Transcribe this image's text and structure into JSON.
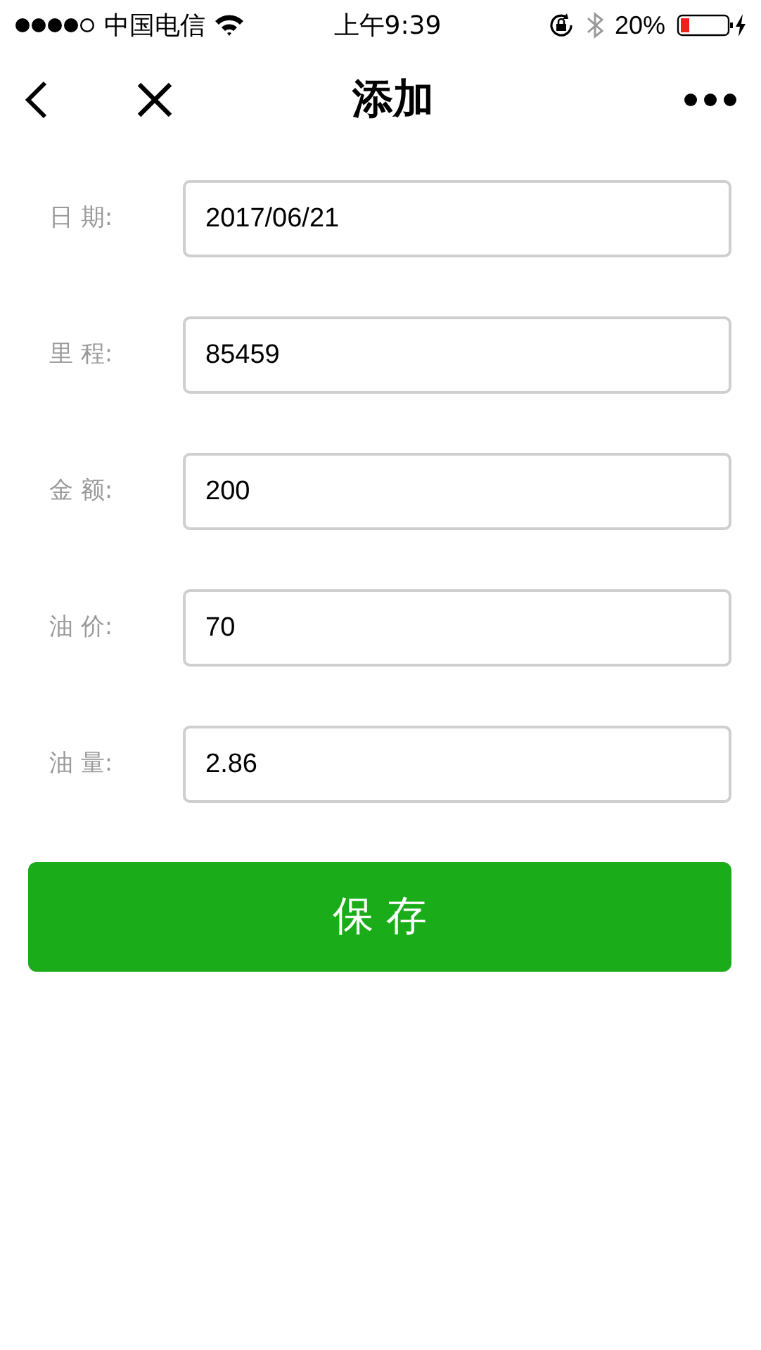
{
  "status_bar": {
    "carrier": "中国电信",
    "time": "上午9:39",
    "battery": "20%"
  },
  "nav_bar": {
    "title": "添加"
  },
  "form": {
    "fields": [
      {
        "label": "日 期:",
        "value": "2017/06/21"
      },
      {
        "label": "里 程:",
        "value": "85459"
      },
      {
        "label": "金 额:",
        "value": "200"
      },
      {
        "label": "油 价:",
        "value": "70"
      },
      {
        "label": "油 量:",
        "value": "2.86"
      }
    ],
    "save_button": "保 存"
  }
}
